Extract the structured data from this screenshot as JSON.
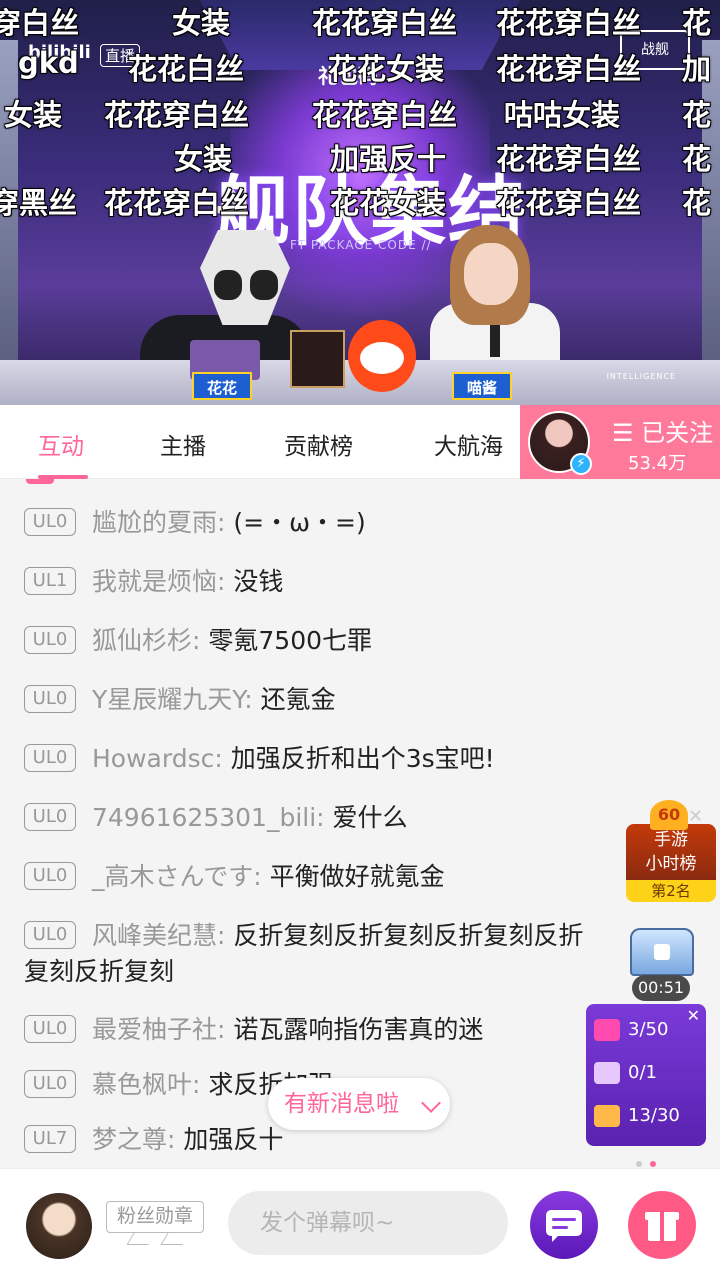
{
  "video": {
    "bili_logo": "bilibili",
    "bili_tag": "直播",
    "gift_code_label": "礼包码",
    "title": "舰队集结",
    "subtitle": "FT PACKAGE CODE //",
    "corner_logo": "战舰",
    "intelligence": "INTELLIGENCE",
    "nameplate_left": "花花",
    "nameplate_right": "喵酱",
    "danmaku": [
      {
        "text": "穿白丝"
      },
      {
        "text": "女装"
      },
      {
        "text": "花花穿白丝"
      },
      {
        "text": "花花穿白丝"
      },
      {
        "text": "花"
      },
      {
        "text": "gkd"
      },
      {
        "text": "花花白丝"
      },
      {
        "text": "花花女装"
      },
      {
        "text": "花花穿白丝"
      },
      {
        "text": "加"
      },
      {
        "text": "女装"
      },
      {
        "text": "花花穿白丝"
      },
      {
        "text": "花花穿白丝"
      },
      {
        "text": "咕咕女装"
      },
      {
        "text": "花"
      },
      {
        "text": "女装"
      },
      {
        "text": "加强反十"
      },
      {
        "text": "花花穿白丝"
      },
      {
        "text": "花"
      },
      {
        "text": "穿黑丝"
      },
      {
        "text": "花花穿白丝"
      },
      {
        "text": "花花女装"
      },
      {
        "text": "花花穿白丝"
      },
      {
        "text": "花"
      }
    ]
  },
  "tabs": {
    "items": [
      {
        "label": "互动"
      },
      {
        "label": "主播"
      },
      {
        "label": "贡献榜"
      },
      {
        "label": "大航海"
      }
    ],
    "active_index": 0
  },
  "follow": {
    "label": "☰ 已关注",
    "count": "53.4万"
  },
  "chat": {
    "messages": [
      {
        "level": "UL0",
        "user": "尴尬的夏雨:",
        "text": "(=・ω・=)"
      },
      {
        "level": "UL1",
        "user": "我就是烦恼:",
        "text": "没钱"
      },
      {
        "level": "UL0",
        "user": "狐仙杉杉:",
        "text": "零氪7500七罪"
      },
      {
        "level": "UL0",
        "user": "Y星辰耀九天Y:",
        "text": "还氪金"
      },
      {
        "level": "UL0",
        "user": "Howardsc:",
        "text": "加强反折和出个3s宝吧!"
      },
      {
        "level": "UL0",
        "user": "74961625301_bili:",
        "text": "爱什么"
      },
      {
        "level": "UL0",
        "user": "_高木さんです:",
        "text": "平衡做好就氪金"
      },
      {
        "level": "UL0",
        "user": "风峰美纪慧:",
        "text": "反折复刻反折复刻反折复刻反折复刻反折复刻"
      },
      {
        "level": "UL0",
        "user": "最爱柚子社:",
        "text": "诺瓦露响指伤害真的迷"
      },
      {
        "level": "UL0",
        "user": "慕色枫叶:",
        "text": "求反折加强"
      },
      {
        "level": "UL7",
        "user": "梦之尊:",
        "text": "加强反十"
      }
    ],
    "new_message_label": "有新消息啦"
  },
  "widgets": {
    "rank_level": "60",
    "rank_title_line1": "手游",
    "rank_title_line2": "小时榜",
    "rank_position": "第2名",
    "chest_timer": "00:51",
    "tasks": [
      {
        "progress": "3/50",
        "color": "#ff4ab0"
      },
      {
        "progress": "0/1",
        "color": "#e6c8ff"
      },
      {
        "progress": "13/30",
        "color": "#ffb84a"
      }
    ]
  },
  "bottom": {
    "fan_medal": "粉丝勋章",
    "input_placeholder": "发个弹幕呗~"
  },
  "colors": {
    "accent": "#ff6699",
    "follow_bg": "#ff7a9a"
  }
}
